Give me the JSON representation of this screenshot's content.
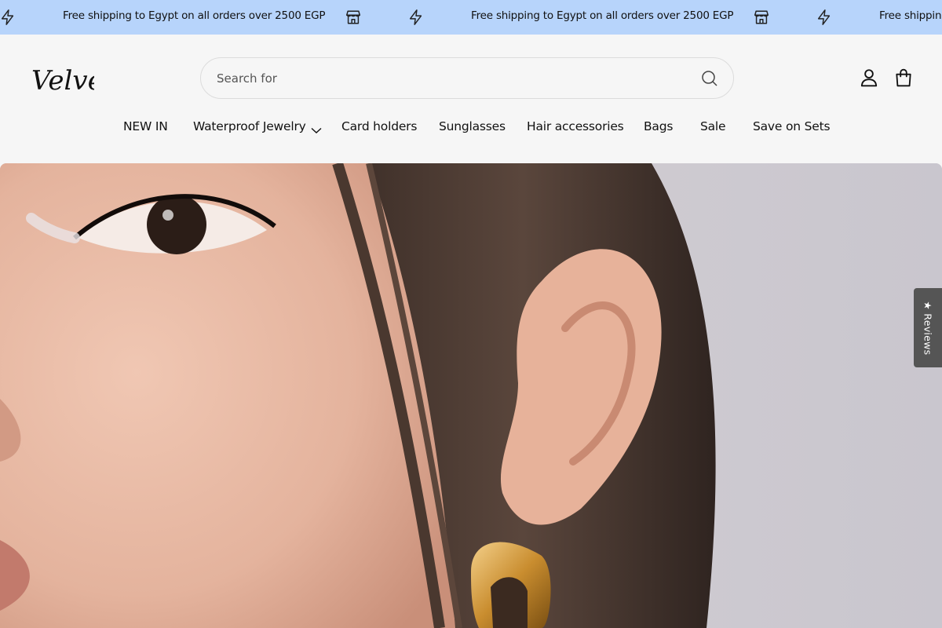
{
  "announcement": {
    "message": "Free shipping to Egypt on all orders over 2500 EGP",
    "icons": [
      "lightning-icon",
      "store-icon"
    ]
  },
  "header": {
    "logo_text": "Velvet",
    "search": {
      "placeholder": "Search for",
      "value": ""
    },
    "icons": [
      "search-icon",
      "account-icon",
      "cart-bag-icon"
    ]
  },
  "nav": {
    "items": [
      {
        "label": "NEW IN"
      },
      {
        "label": "Waterproof Jewelry",
        "has_dropdown": true
      },
      {
        "label": "Card holders"
      },
      {
        "label": "Sunglasses"
      },
      {
        "label": "Hair accessories"
      },
      {
        "label": "Bags"
      },
      {
        "label": "Sale"
      },
      {
        "label": "Save on Sets"
      }
    ]
  },
  "reviews_tab": {
    "label": "★ Reviews"
  },
  "colors": {
    "announcement_bg": "#b7d4fb",
    "header_bg": "#f6f6f6",
    "reviews_tab_bg": "#555555"
  }
}
